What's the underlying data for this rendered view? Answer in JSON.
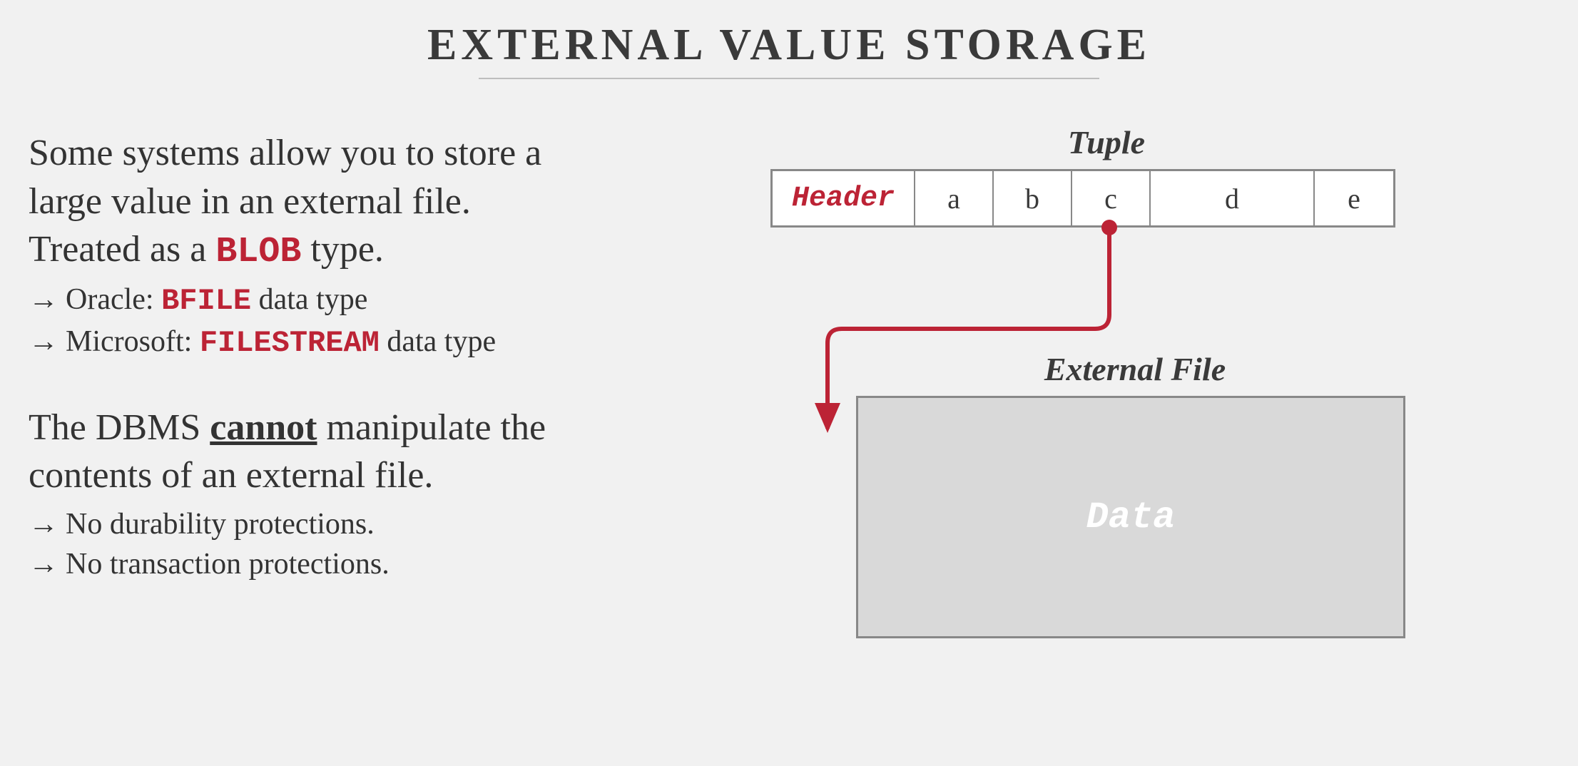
{
  "title": "EXTERNAL VALUE STORAGE",
  "para1_line1": "Some systems allow you to store a",
  "para1_line2": "large value in an external file.",
  "para1_line3_pre": "Treated as a ",
  "para1_line3_kw": "BLOB",
  "para1_line3_post": " type.",
  "sub1_arrow": "→",
  "sub1_pre": "Oracle: ",
  "sub1_kw": "BFILE",
  "sub1_post": " data type",
  "sub2_arrow": "→",
  "sub2_pre": "Microsoft: ",
  "sub2_kw": "FILESTREAM",
  "sub2_post": " data type",
  "para2_pre": "The DBMS ",
  "para2_cannot": "cannot",
  "para2_mid": " manipulate the",
  "para2_line2": "contents of an external file.",
  "sub3_arrow": "→",
  "sub3_text": "No durability protections.",
  "sub4_arrow": "→",
  "sub4_text": "No transaction protections.",
  "diagram": {
    "tuple_label": "Tuple",
    "header": "Header",
    "cells": {
      "a": "a",
      "b": "b",
      "c": "c",
      "d": "d",
      "e": "e"
    },
    "ext_label": "External File",
    "ext_data": "Data"
  },
  "colors": {
    "accent": "#bc2335",
    "bg": "#f1f1f1",
    "text": "#333333",
    "box_border": "#888888",
    "box_fill": "#d9d9d9"
  }
}
